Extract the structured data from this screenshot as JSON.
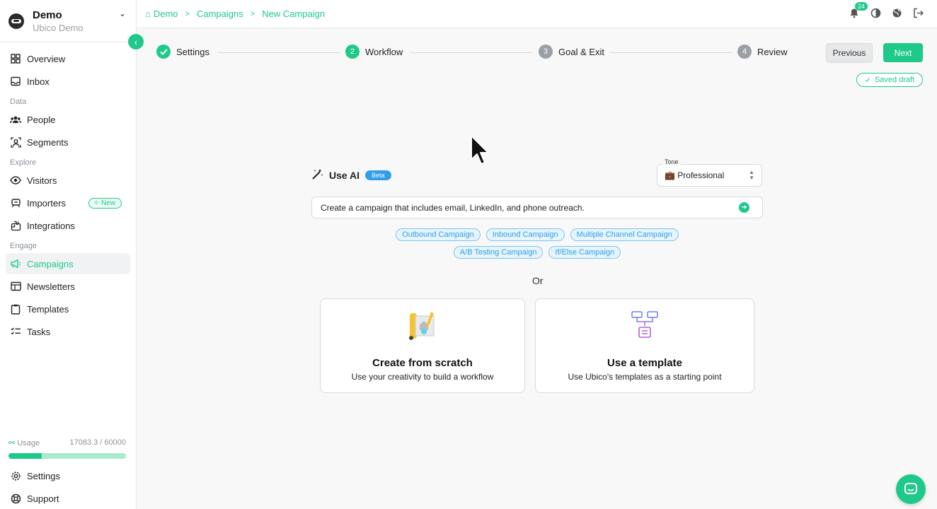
{
  "brand": {
    "name": "Demo",
    "subtitle": "Ubico Demo"
  },
  "sidebar": {
    "items_top": [
      {
        "label": "Overview",
        "icon": "grid-icon"
      },
      {
        "label": "Inbox",
        "icon": "inbox-icon"
      }
    ],
    "section_data": "Data",
    "items_data": [
      {
        "label": "People",
        "icon": "people-icon"
      },
      {
        "label": "Segments",
        "icon": "segments-icon"
      }
    ],
    "section_explore": "Explore",
    "items_explore": [
      {
        "label": "Visitors",
        "icon": "eye-icon"
      },
      {
        "label": "Importers",
        "icon": "importers-icon",
        "badge": "New"
      },
      {
        "label": "Integrations",
        "icon": "integrations-icon"
      }
    ],
    "section_engage": "Engage",
    "items_engage": [
      {
        "label": "Campaigns",
        "icon": "megaphone-icon",
        "active": true
      },
      {
        "label": "Newsletters",
        "icon": "newsletter-icon"
      },
      {
        "label": "Templates",
        "icon": "templates-icon"
      },
      {
        "label": "Tasks",
        "icon": "tasks-icon"
      }
    ],
    "usage": {
      "label": "Usage",
      "value": "17083.3 / 60000",
      "fraction": 0.2847
    },
    "items_bottom": [
      {
        "label": "Settings",
        "icon": "gear-icon"
      },
      {
        "label": "Support",
        "icon": "support-icon"
      }
    ]
  },
  "breadcrumb": [
    "Demo",
    "Campaigns",
    "New Campaign"
  ],
  "notifications": {
    "count": "24"
  },
  "stepper": [
    {
      "num": "1",
      "label": "Settings",
      "state": "done"
    },
    {
      "num": "2",
      "label": "Workflow",
      "state": "current"
    },
    {
      "num": "3",
      "label": "Goal & Exit",
      "state": "todo"
    },
    {
      "num": "4",
      "label": "Review",
      "state": "todo"
    }
  ],
  "actions": {
    "previous": "Previous",
    "next": "Next",
    "saved": "Saved draft"
  },
  "ai": {
    "title": "Use AI",
    "badge": "Beta",
    "tone_label": "Tone",
    "tone_value": "💼 Professional",
    "prompt": "Create a campaign that includes email, LinkedIn, and phone outreach.",
    "chips_row1": [
      "Outbound Campaign",
      "Inbound Campaign",
      "Multiple Channel Campaign"
    ],
    "chips_row2": [
      "A/B Testing Campaign",
      "If/Else Campaign"
    ]
  },
  "or_text": "Or",
  "cards": [
    {
      "title": "Create from scratch",
      "subtitle": "Use your creativity to build a workflow"
    },
    {
      "title": "Use a template",
      "subtitle": "Use Ubico's templates as a starting point"
    }
  ],
  "colors": {
    "accent": "#1fc98a",
    "blue": "#2f9fe8",
    "usage_track": "#a8ebcf"
  }
}
